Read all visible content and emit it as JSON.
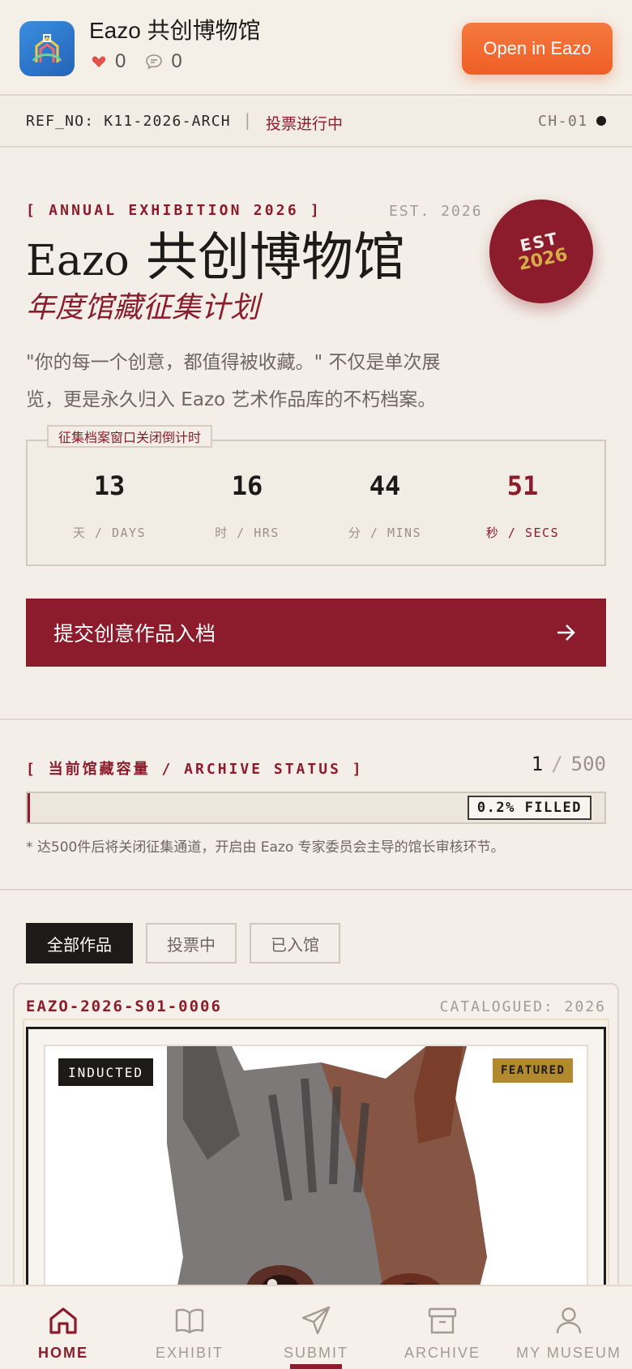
{
  "app_banner": {
    "title": "Eazo 共创博物馆",
    "likes": "0",
    "comments": "0",
    "open_button": "Open in Eazo"
  },
  "ref_bar": {
    "ref_no": "REF_NO: K11-2026-ARCH",
    "separator": "|",
    "status": "投票进行中",
    "channel": "CH-01"
  },
  "hero": {
    "exhibition_label": "[ ANNUAL EXHIBITION 2026 ]",
    "est_small": "EST. 2026",
    "seal_est": "EST",
    "seal_year": "2026",
    "title_latin": "Eazo",
    "title_cjk": "共创博物馆",
    "subtitle": "年度馆藏征集计划",
    "description": "\"你的每一个创意，都值得被收藏。\" 不仅是单次展览，更是永久归入 Eazo 艺术作品库的不朽档案。"
  },
  "countdown": {
    "tag": "征集档案窗口关闭倒计时",
    "cells": [
      {
        "value": "13",
        "label": "天 / DAYS"
      },
      {
        "value": "16",
        "label": "时 / HRS"
      },
      {
        "value": "44",
        "label": "分 / MINS"
      },
      {
        "value": "51",
        "label": "秒 / SECS"
      }
    ]
  },
  "submit_button": "提交创意作品入档",
  "archive_status": {
    "label": "[ 当前馆藏容量 / ARCHIVE STATUS ]",
    "current": "1",
    "separator": "/",
    "total": "500",
    "fill_fraction": 0.002,
    "filled_badge": "0.2% FILLED",
    "note": "* 达500件后将关闭征集通道，开启由 Eazo 专家委员会主导的馆长审核环节。"
  },
  "filter_tabs": [
    {
      "label": "全部作品",
      "active": true
    },
    {
      "label": "投票中",
      "active": false
    },
    {
      "label": "已入馆",
      "active": false
    }
  ],
  "artwork_card": {
    "id": "EAZO-2026-S01-0006",
    "catalogued": "CATALOGUED: 2026",
    "badge_inducted": "INDUCTED",
    "badge_featured": "FEATURED"
  },
  "bottom_nav": [
    {
      "label": "HOME",
      "icon": "home-icon",
      "active": true
    },
    {
      "label": "EXHIBIT",
      "icon": "book-icon",
      "active": false
    },
    {
      "label": "SUBMIT",
      "icon": "send-icon",
      "active": false
    },
    {
      "label": "ARCHIVE",
      "icon": "archive-box-icon",
      "active": false
    },
    {
      "label": "MY MUSEUM",
      "icon": "user-icon",
      "active": false
    }
  ],
  "colors": {
    "brand_red": "#8c1c2b",
    "accent_orange": "#ee5e26",
    "gold": "#b08a2c",
    "background": "#f3efe8"
  }
}
